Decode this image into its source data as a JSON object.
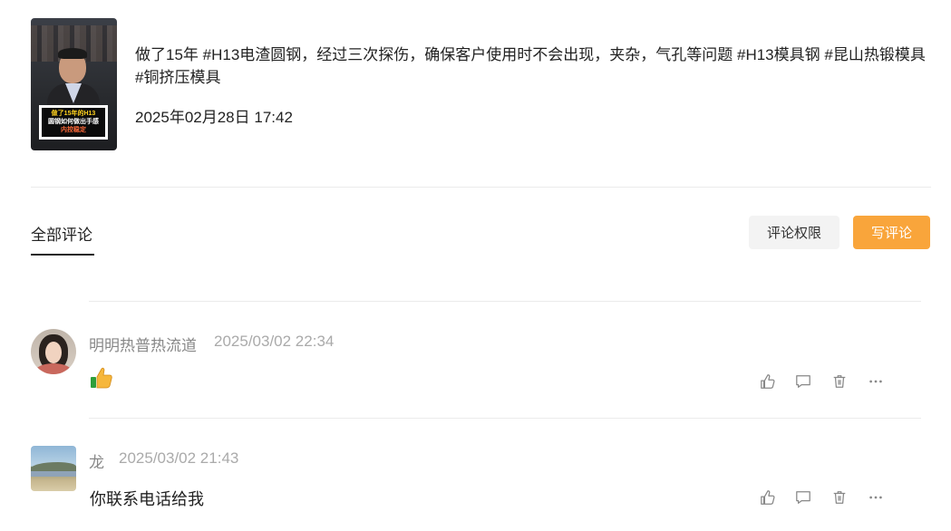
{
  "post": {
    "thumbnail_caption": [
      "做了15年的H13",
      "圆钢如何做出手感",
      "内控稳定"
    ],
    "text": "做了15年 #H13电渣圆钢，经过三次探伤，确保客户使用时不会出现，夹杂，气孔等问题 #H13模具钢 #昆山热锻模具 #铜挤压模具",
    "time": "2025年02月28日 17:42"
  },
  "comments_header": {
    "tab_all": "全部评论",
    "perm_button": "评论权限",
    "write_button": "写评论"
  },
  "comments": [
    {
      "name": "明明热普热流道",
      "time": "2025/03/02 22:34",
      "content": "",
      "content_icon": "thumbs-up-emoji",
      "avatar": "woman-avatar"
    },
    {
      "name": "龙",
      "time": "2025/03/02 21:43",
      "content": "你联系电话给我",
      "avatar": "landscape-avatar"
    }
  ],
  "actions": [
    "like-icon",
    "reply-icon",
    "delete-icon",
    "more-icon"
  ],
  "colors": {
    "accent": "#f9a53b",
    "secondary_button": "#f3f3f3",
    "divider": "#ebebeb",
    "muted_text": "#888888"
  }
}
